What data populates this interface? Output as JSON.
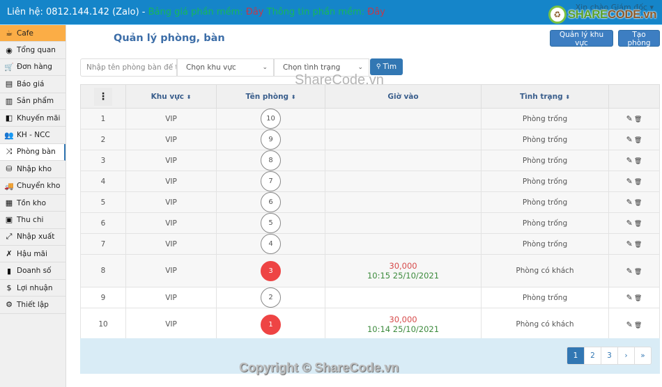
{
  "topbar": {
    "contact": "Liên hệ: 0812.144.142 (Zalo) - ",
    "price_label": "Bảng giá phần mềm: ",
    "price_link": "Đây",
    "info_label": " Thông tin phần mềm: ",
    "info_link": "Đây",
    "greeting": "Xin chào Giám đốc ▾",
    "logo_green": "SHARE",
    "logo_brown": "CODE.vn"
  },
  "sidebar": {
    "items": [
      {
        "label": "Cafe",
        "icon": "☕"
      },
      {
        "label": "Tổng quan",
        "icon": "◉"
      },
      {
        "label": "Đơn hàng",
        "icon": "🛒"
      },
      {
        "label": "Báo giá",
        "icon": "▤"
      },
      {
        "label": "Sản phẩm",
        "icon": "▥"
      },
      {
        "label": "Khuyến mãi",
        "icon": "◧"
      },
      {
        "label": "KH - NCC",
        "icon": "👥"
      },
      {
        "label": "Phòng bàn",
        "icon": "⤨"
      },
      {
        "label": "Nhập kho",
        "icon": "⛁"
      },
      {
        "label": "Chuyển kho",
        "icon": "🚚"
      },
      {
        "label": "Tồn kho",
        "icon": "▦"
      },
      {
        "label": "Thu chi",
        "icon": "▣"
      },
      {
        "label": "Nhập xuất",
        "icon": "⤢"
      },
      {
        "label": "Hậu mãi",
        "icon": "✗"
      },
      {
        "label": "Doanh số",
        "icon": "▮"
      },
      {
        "label": "Lợi nhuận",
        "icon": "$"
      },
      {
        "label": "Thiết lập",
        "icon": "⚙"
      }
    ]
  },
  "main": {
    "title": "Quản lý phòng, bàn",
    "btn_area": "Quản lý khu vực",
    "btn_create": "Tạo phòng",
    "search_placeholder": "Nhập tên phòng bàn để tìm",
    "select_area": "Chọn khu vực",
    "select_status": "Chọn tình trạng",
    "search_btn": "Tìm",
    "search_icon": "🔍"
  },
  "table": {
    "headers": {
      "menu": "⋮",
      "area": "Khu vực",
      "name": "Tên phòng",
      "time": "Giờ vào",
      "status": "Tình trạng",
      "sort": "⬍"
    },
    "rows": [
      {
        "idx": "1",
        "area": "VIP",
        "room": "10",
        "price": "",
        "time": "",
        "status": "Phòng trống",
        "busy": false
      },
      {
        "idx": "2",
        "area": "VIP",
        "room": "9",
        "price": "",
        "time": "",
        "status": "Phòng trống",
        "busy": false
      },
      {
        "idx": "3",
        "area": "VIP",
        "room": "8",
        "price": "",
        "time": "",
        "status": "Phòng trống",
        "busy": false
      },
      {
        "idx": "4",
        "area": "VIP",
        "room": "7",
        "price": "",
        "time": "",
        "status": "Phòng trống",
        "busy": false
      },
      {
        "idx": "5",
        "area": "VIP",
        "room": "6",
        "price": "",
        "time": "",
        "status": "Phòng trống",
        "busy": false
      },
      {
        "idx": "6",
        "area": "VIP",
        "room": "5",
        "price": "",
        "time": "",
        "status": "Phòng trống",
        "busy": false
      },
      {
        "idx": "7",
        "area": "VIP",
        "room": "4",
        "price": "",
        "time": "",
        "status": "Phòng trống",
        "busy": false
      },
      {
        "idx": "8",
        "area": "VIP",
        "room": "3",
        "price": "30,000",
        "time": "10:15 25/10/2021",
        "status": "Phòng có khách",
        "busy": true
      },
      {
        "idx": "9",
        "area": "VIP",
        "room": "2",
        "price": "",
        "time": "",
        "status": "Phòng trống",
        "busy": false
      },
      {
        "idx": "10",
        "area": "VIP",
        "room": "1",
        "price": "30,000",
        "time": "10:14 25/10/2021",
        "status": "Phòng có khách",
        "busy": true
      }
    ],
    "edit_icon": "✎",
    "delete_icon": "🗑"
  },
  "pagination": [
    "1",
    "2",
    "3",
    "›",
    "»"
  ],
  "watermarks": {
    "center": "ShareCode.vn",
    "copyright": "Copyright © ShareCode.vn"
  }
}
